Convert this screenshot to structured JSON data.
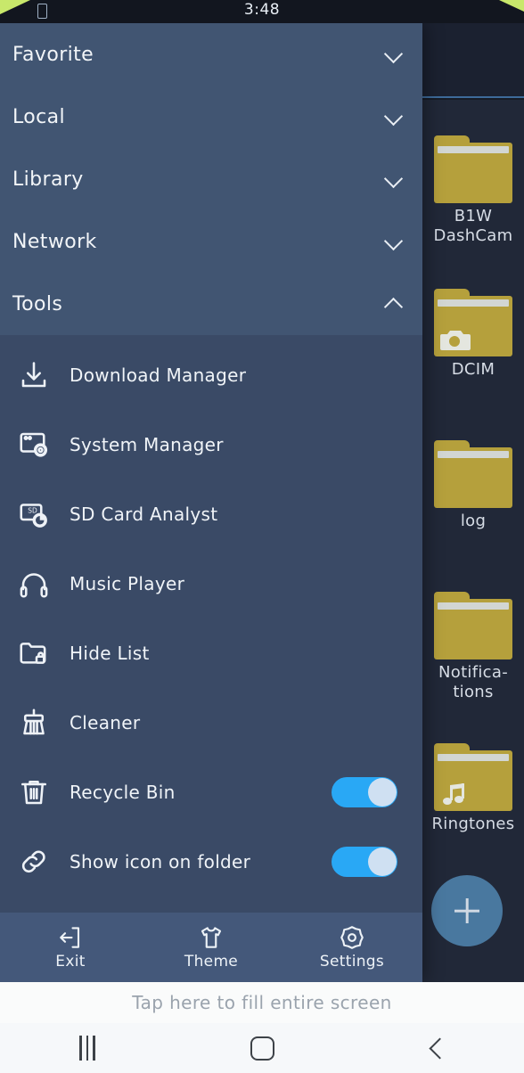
{
  "status_bar": {
    "time": "3:48",
    "left_icon": "sim-card-icon"
  },
  "app_header": {
    "close_icon": "close-icon",
    "overflow_icon": "more-vertical-icon"
  },
  "files": [
    {
      "name": "B1W\nDashCam",
      "badge": ""
    },
    {
      "name": "DCIM",
      "badge": "camera-icon"
    },
    {
      "name": "log",
      "badge": ""
    },
    {
      "name": "Notifica-\ntions",
      "badge": ""
    },
    {
      "name": "Ringtones",
      "badge": "music-note-icon"
    }
  ],
  "fab": {
    "icon": "plus-icon"
  },
  "drawer": {
    "sections": [
      {
        "label": "Favorite",
        "expanded": false,
        "chevron": "chevron-down-icon"
      },
      {
        "label": "Local",
        "expanded": false,
        "chevron": "chevron-down-icon"
      },
      {
        "label": "Library",
        "expanded": false,
        "chevron": "chevron-down-icon"
      },
      {
        "label": "Network",
        "expanded": false,
        "chevron": "chevron-down-icon"
      },
      {
        "label": "Tools",
        "expanded": true,
        "chevron": "chevron-up-icon"
      }
    ],
    "tools": [
      {
        "label": "Download Manager",
        "icon": "download-icon",
        "toggle": null
      },
      {
        "label": "System Manager",
        "icon": "system-gear-icon",
        "toggle": null
      },
      {
        "label": "SD Card Analyst",
        "icon": "sd-card-chart-icon",
        "toggle": null
      },
      {
        "label": "Music Player",
        "icon": "headphones-icon",
        "toggle": null
      },
      {
        "label": "Hide List",
        "icon": "folder-lock-icon",
        "toggle": null
      },
      {
        "label": "Cleaner",
        "icon": "broom-icon",
        "toggle": null
      },
      {
        "label": "Recycle Bin",
        "icon": "trash-icon",
        "toggle": "on"
      },
      {
        "label": "Show icon on folder",
        "icon": "link-icon",
        "toggle": "on"
      }
    ],
    "bottom_bar": [
      {
        "label": "Exit",
        "icon": "exit-icon"
      },
      {
        "label": "Theme",
        "icon": "tshirt-icon"
      },
      {
        "label": "Settings",
        "icon": "gear-icon"
      }
    ]
  },
  "fill_hint": {
    "text": "Tap here to fill entire screen"
  },
  "nav_bar": {
    "recents": "recents-icon",
    "home": "home-icon",
    "back": "back-icon"
  },
  "colors": {
    "drawer_top": "#415572",
    "drawer_submenu": "#3a4a66",
    "drawer_bottom": "#44587a",
    "toggle_on": "#29a8f5",
    "folder": "#b5a03c",
    "accent_underline": "#3d6a99",
    "fab": "#4d7fa8",
    "status_corner": "#c8e86b"
  }
}
